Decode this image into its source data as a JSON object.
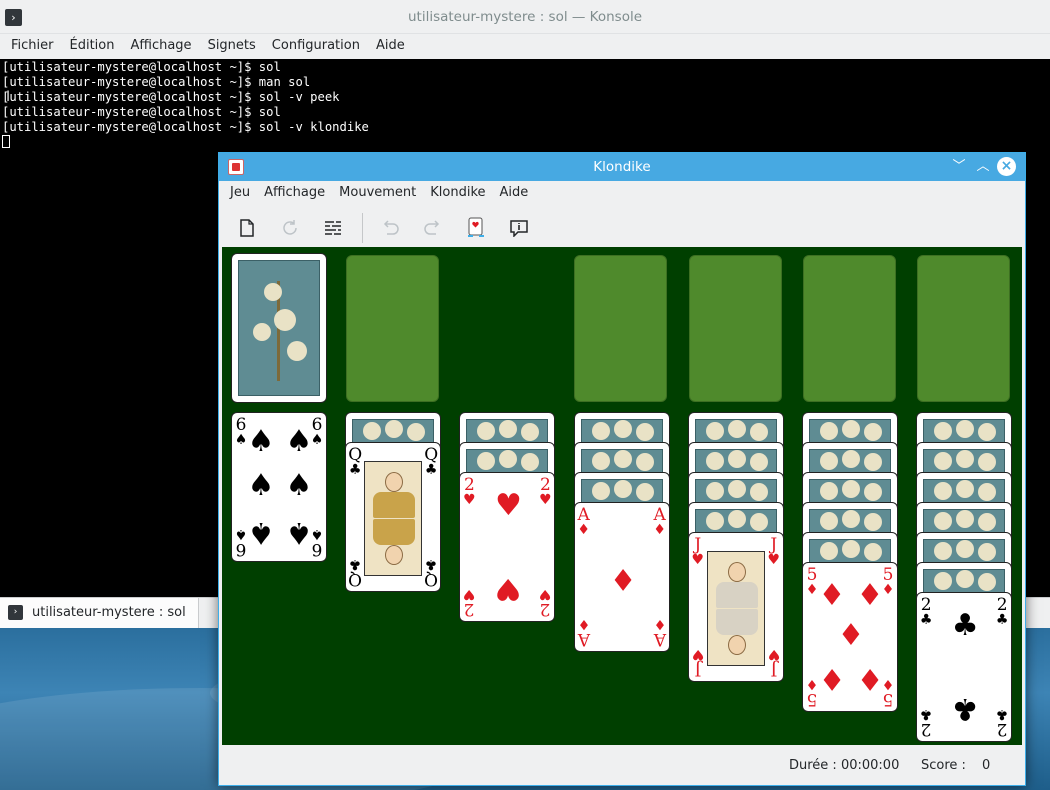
{
  "konsole": {
    "title": "utilisateur-mystere : sol — Konsole",
    "menu": [
      "Fichier",
      "Édition",
      "Affichage",
      "Signets",
      "Configuration",
      "Aide"
    ],
    "lines": [
      "[utilisateur-mystere@localhost ~]$ sol",
      "[utilisateur-mystere@localhost ~]$ man sol",
      "[utilisateur-mystere@localhost ~]$ sol -v peek",
      "[utilisateur-mystere@localhost ~]$ sol",
      "[utilisateur-mystere@localhost ~]$ sol -v klondike"
    ],
    "tab_label": "utilisateur-mystere : sol"
  },
  "klondike": {
    "title": "Klondike",
    "menu": [
      "Jeu",
      "Affichage",
      "Mouvement",
      "Klondike",
      "Aide"
    ],
    "toolbar": [
      {
        "icon": "new-game-icon",
        "enabled": true
      },
      {
        "icon": "redeal-icon",
        "enabled": false
      },
      {
        "icon": "game-type-icon",
        "enabled": true
      },
      {
        "icon": "undo-icon",
        "enabled": false
      },
      {
        "icon": "redo-icon",
        "enabled": false
      },
      {
        "icon": "hint-icon",
        "enabled": true
      },
      {
        "icon": "info-icon",
        "enabled": true
      }
    ],
    "status": {
      "duration_label": "Durée : 00:00:00",
      "score_label": "Score :",
      "score_value": "0"
    },
    "tableau": [
      {
        "hidden": 0,
        "top": {
          "rank": "6",
          "suit": "♠",
          "color": "black"
        }
      },
      {
        "hidden": 1,
        "top": {
          "rank": "Q",
          "suit": "♣",
          "color": "black"
        }
      },
      {
        "hidden": 2,
        "top": {
          "rank": "2",
          "suit": "♥",
          "color": "red"
        }
      },
      {
        "hidden": 3,
        "top": {
          "rank": "A",
          "suit": "♦",
          "color": "red"
        }
      },
      {
        "hidden": 4,
        "top": {
          "rank": "J",
          "suit": "♥",
          "color": "red"
        }
      },
      {
        "hidden": 5,
        "top": {
          "rank": "5",
          "suit": "♦",
          "color": "red"
        }
      },
      {
        "hidden": 6,
        "top": {
          "rank": "2",
          "suit": "♣",
          "color": "black"
        }
      }
    ]
  },
  "colors": {
    "felt": "#003f00",
    "slot": "#4f8a2c",
    "titlebar": "#47a9e2",
    "red_suit": "#e01b24"
  }
}
